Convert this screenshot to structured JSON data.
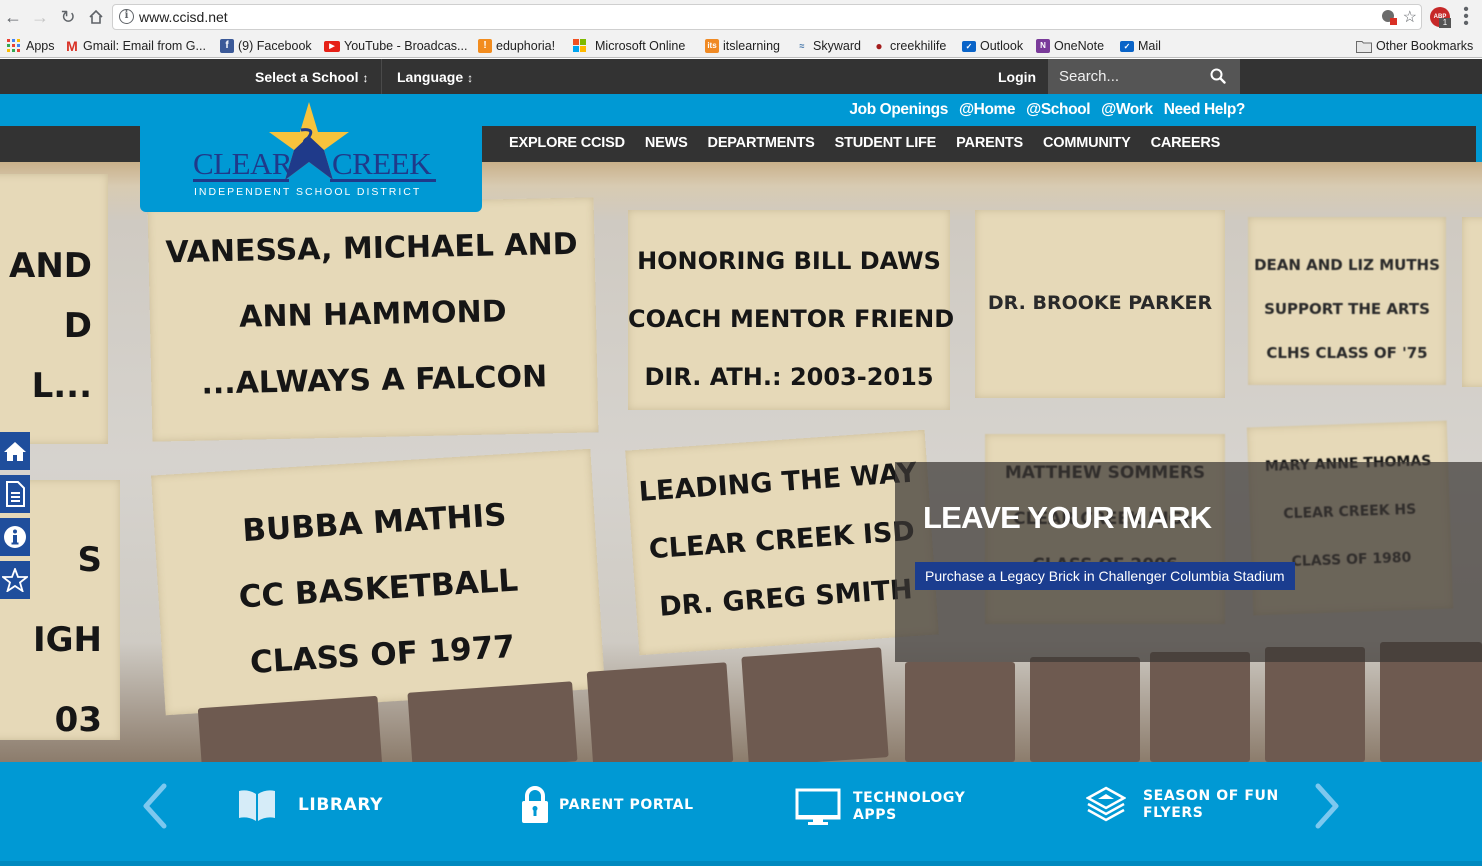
{
  "browser": {
    "url": "www.ccisd.net",
    "bookmarks": [
      {
        "label": "Apps",
        "icon": "apps-grid-icon",
        "color": "#4a4a4a"
      },
      {
        "label": "Gmail: Email from G...",
        "icon": "gmail-icon",
        "color": "#d93025"
      },
      {
        "label": "(9) Facebook",
        "icon": "facebook-icon",
        "color": "#3b5998"
      },
      {
        "label": "YouTube - Broadcas...",
        "icon": "youtube-icon",
        "color": "#e62117"
      },
      {
        "label": "eduphoria!",
        "icon": "eduphoria-icon",
        "color": "#f28c1e"
      },
      {
        "label": "Microsoft Online",
        "icon": "microsoft-icon",
        "color": "#f25022"
      },
      {
        "label": "itslearning",
        "icon": "itslearning-icon",
        "color": "#f08a24"
      },
      {
        "label": "Skyward",
        "icon": "skyward-icon",
        "color": "#3a6ea5"
      },
      {
        "label": "creekhilife",
        "icon": "paw-icon",
        "color": "#a31c1c"
      },
      {
        "label": "Outlook",
        "icon": "mail-icon",
        "color": "#0a64c8"
      },
      {
        "label": "OneNote",
        "icon": "onenote-icon",
        "color": "#7a3b9a"
      },
      {
        "label": "Mail",
        "icon": "mail-icon",
        "color": "#0a64c8"
      }
    ],
    "other_bookmarks": "Other Bookmarks",
    "extension_badge": "1",
    "extension_label": "ABP"
  },
  "topbar": {
    "select_school": "Select a School",
    "language": "Language",
    "login": "Login",
    "search_placeholder": "Search..."
  },
  "quicklinks": [
    "Job Openings",
    "@Home",
    "@School",
    "@Work",
    "Need Help?"
  ],
  "logo": {
    "word1": "CLEAR",
    "word2": "CREEK",
    "subtitle": "INDEPENDENT SCHOOL DISTRICT"
  },
  "mainnav": [
    "EXPLORE CCISD",
    "NEWS",
    "DEPARTMENTS",
    "STUDENT LIFE",
    "PARENTS",
    "COMMUNITY",
    "CAREERS"
  ],
  "hero": {
    "title": "LEAVE YOUR MARK",
    "cta": "Purchase a Legacy Brick in Challenger Columbia Stadium",
    "bricks": [
      {
        "lines": [
          "AND",
          "D",
          "L..."
        ]
      },
      {
        "lines": [
          "VANESSA, MICHAEL AND",
          "ANN HAMMOND",
          "...ALWAYS A FALCON"
        ]
      },
      {
        "lines": [
          "HONORING BILL DAWS",
          "COACH MENTOR FRIEND",
          "DIR. ATH.: 2003-2015"
        ]
      },
      {
        "lines": [
          "DR. BROOKE PARKER"
        ]
      },
      {
        "lines": [
          "DEAN AND LIZ MUTHS",
          "SUPPORT THE ARTS",
          "CLHS CLASS OF '75"
        ]
      },
      {
        "lines": [
          "S",
          "IGH",
          "03"
        ]
      },
      {
        "lines": [
          "BUBBA MATHIS",
          "CC BASKETBALL",
          "CLASS OF 1977"
        ]
      },
      {
        "lines": [
          "LEADING THE WAY",
          "CLEAR CREEK ISD",
          "DR. GREG SMITH"
        ]
      },
      {
        "lines": [
          "MATTHEW SOMMERS",
          "CLEAR CREEK HIGH",
          "CLASS OF 2006"
        ]
      },
      {
        "lines": [
          "MARY ANNE THOMAS",
          "CLEAR CREEK HS",
          "CLASS OF 1980"
        ]
      }
    ]
  },
  "side_tools": [
    {
      "icon": "home-icon"
    },
    {
      "icon": "document-icon"
    },
    {
      "icon": "info-icon"
    },
    {
      "icon": "star-icon"
    }
  ],
  "strip": {
    "items": [
      {
        "label": "LIBRARY",
        "icon": "book-icon"
      },
      {
        "label": "PARENT PORTAL",
        "icon": "lock-icon"
      },
      {
        "label_line1": "TECHNOLOGY",
        "label_line2": "APPS",
        "icon": "monitor-icon"
      },
      {
        "label_line1": "SEASON OF FUN",
        "label_line2": "FLYERS",
        "icon": "layers-icon"
      }
    ]
  },
  "colors": {
    "dark_bar": "#333333",
    "brand_blue": "#0099d4",
    "navy": "#1f3a8a",
    "cta_blue": "#1b3d8f",
    "star_gold": "#f7c33c"
  }
}
